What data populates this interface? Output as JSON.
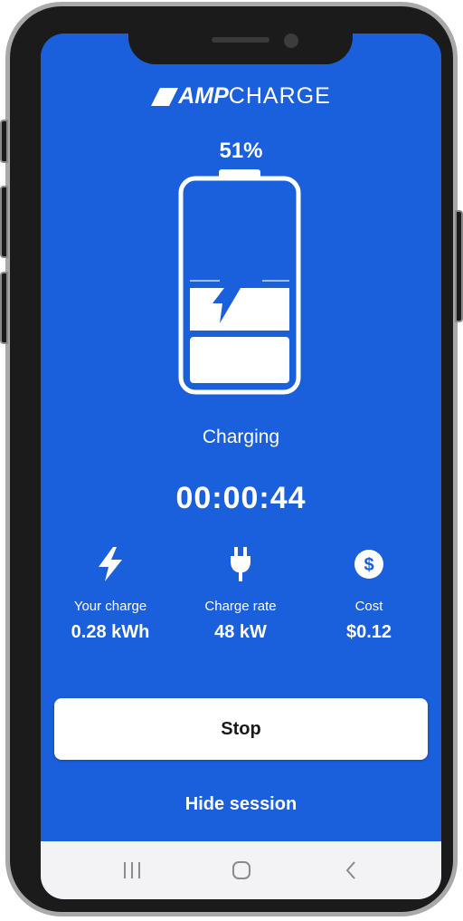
{
  "brand": {
    "amp": "AMP",
    "charge": "CHARGE"
  },
  "battery": {
    "percent_label": "51%",
    "level": 0.51
  },
  "session": {
    "status": "Charging",
    "elapsed": "00:00:44"
  },
  "stats": [
    {
      "icon": "bolt-icon",
      "label": "Your charge",
      "value": "0.28 kWh"
    },
    {
      "icon": "plug-icon",
      "label": "Charge rate",
      "value": "48 kW"
    },
    {
      "icon": "dollar-icon",
      "label": "Cost",
      "value": "$0.12"
    }
  ],
  "actions": {
    "stop_label": "Stop",
    "hide_label": "Hide session"
  },
  "navbar": {
    "items": [
      "recent-apps-icon",
      "home-icon",
      "back-icon"
    ]
  },
  "colors": {
    "accent": "#1a5fdc",
    "surface": "#ffffff",
    "navbar": "#f3f3f5"
  }
}
